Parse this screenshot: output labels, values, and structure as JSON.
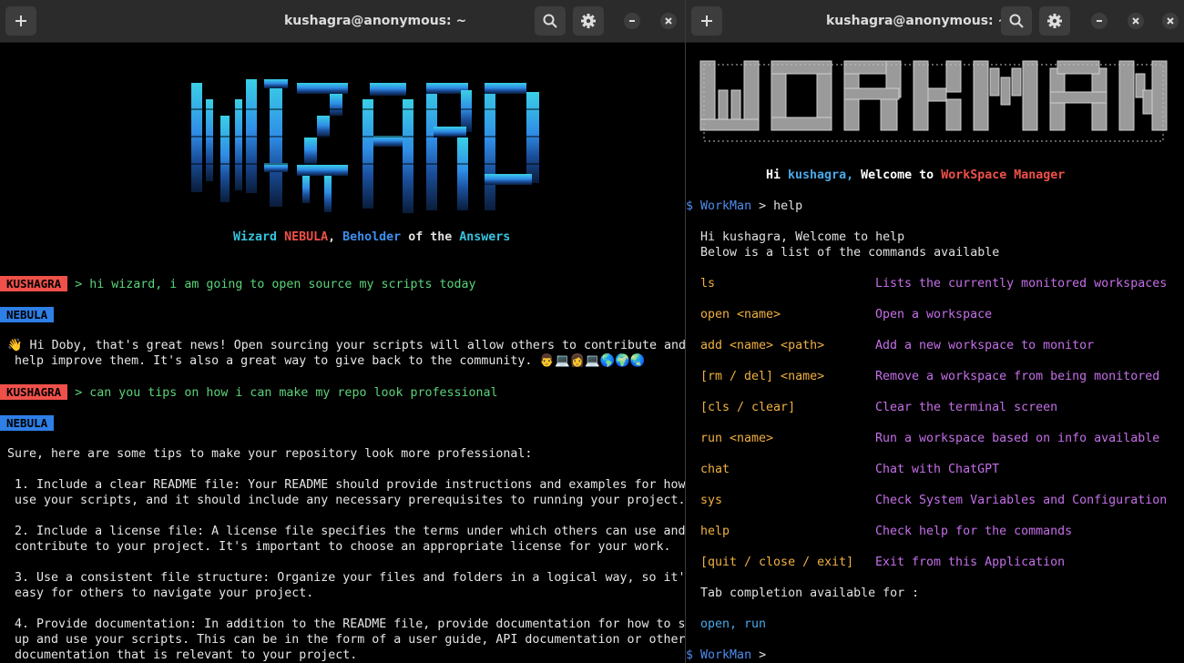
{
  "left": {
    "title": "kushagra@anonymous: ~",
    "banner_art": "WIZARD",
    "subtitle": {
      "w1": "Wizard",
      "w2": "NEBULA",
      "w3": "Beholder",
      "w4": "of the",
      "w5": "Answers"
    },
    "user_label": "KUSHAGRA",
    "bot_label": "NEBULA",
    "msg1": "> hi wizard, i am going to open source my scripts today",
    "reply1_l1": "👋 Hi Doby, that's great news! Open sourcing your scripts will allow others to contribute and",
    "reply1_l2": " help improve them. It's also a great way to give back to the community. 👨💻👩💻🌎🌍🌏",
    "msg2": "> can you tips on how i can make my repo look professional",
    "reply2_lines": [
      "Sure, here are some tips to make your repository look more professional:",
      "",
      " 1. Include a clear README file: Your README should provide instructions and examples for how",
      " use your scripts, and it should include any necessary prerequisites to running your project.",
      "",
      " 2. Include a license file: A license file specifies the terms under which others can use and",
      " contribute to your project. It's important to choose an appropriate license for your work.",
      "",
      " 3. Use a consistent file structure: Organize your files and folders in a logical way, so it'",
      " easy for others to navigate your project.",
      "",
      " 4. Provide documentation: In addition to the README file, provide documentation for how to s",
      " up and use your scripts. This can be in the form of a user guide, API documentation or other",
      " documentation that is relevant to your project."
    ]
  },
  "right": {
    "title": "kushagra@anonymous: ~",
    "banner_art": "WORKMAN",
    "welcome": {
      "hi": "Hi",
      "user": "kushagra,",
      "welcome": "Welcome to",
      "app": "WorkSpace Manager"
    },
    "prompt_symbol": "$",
    "prompt_name": "WorkMan",
    "prompt_arrow": ">",
    "input1": "help",
    "help_intro_1": "Hi kushagra, Welcome to help",
    "help_intro_2": "Below is a list of the commands available",
    "commands": [
      {
        "cmd": "ls",
        "desc": "Lists the currently monitored workspaces"
      },
      {
        "cmd": "open <name>",
        "desc": "Open a workspace"
      },
      {
        "cmd": "add <name> <path>",
        "desc": "Add a new workspace to monitor"
      },
      {
        "cmd": "[rm / del] <name>",
        "desc": "Remove a workspace from being monitored"
      },
      {
        "cmd": "[cls / clear]",
        "desc": "Clear the terminal screen"
      },
      {
        "cmd": "run <name>",
        "desc": "Run a workspace based on info available"
      },
      {
        "cmd": "chat",
        "desc": "Chat with ChatGPT"
      },
      {
        "cmd": "sys",
        "desc": "Check System Variables and Configuration"
      },
      {
        "cmd": "help",
        "desc": "Check help for the commands"
      },
      {
        "cmd": "[quit / close / exit]",
        "desc": "Exit from this Application"
      }
    ],
    "tab_label": "Tab completion available for :",
    "tab_values": "open, run"
  },
  "icons": {
    "new_tab": "plus-icon",
    "search": "search-icon",
    "settings": "gear-icon",
    "minimize": "minimize-icon",
    "maximize": "maximize-icon",
    "close": "close-icon"
  },
  "colors": {
    "user_badge": "#f0504a",
    "bot_badge": "#2e7fe6",
    "command": "#f0b040",
    "description": "#c46fe8",
    "prompt": "#4f8df0"
  }
}
